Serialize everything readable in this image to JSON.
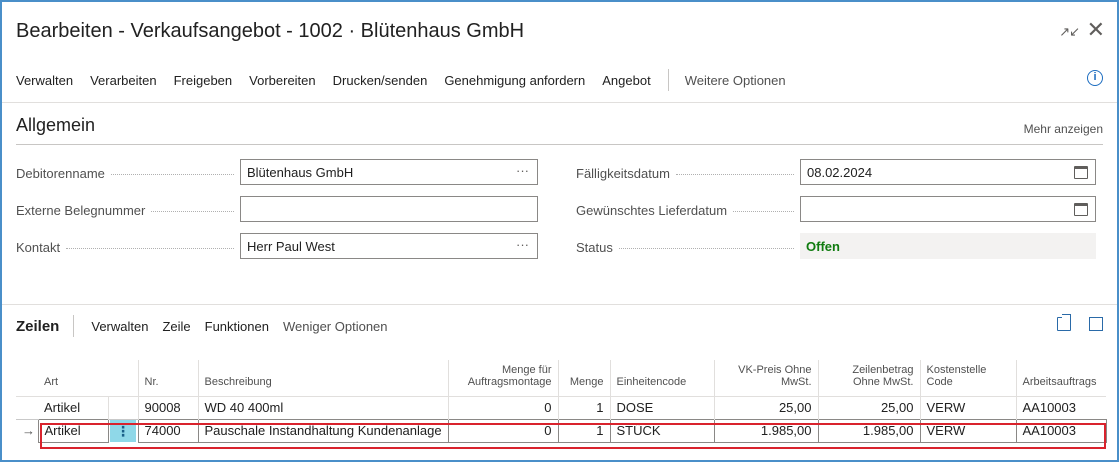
{
  "window": {
    "title": "Bearbeiten - Verkaufsangebot - 1002 · Blütenhaus GmbH",
    "collapse_icon": "collapse-icon",
    "close_icon": "close-icon"
  },
  "actionbar": {
    "items": [
      "Verwalten",
      "Verarbeiten",
      "Freigeben",
      "Vorbereiten",
      "Drucken/senden",
      "Genehmigung anfordern",
      "Angebot"
    ],
    "more": "Weitere Optionen",
    "info_icon": "info-icon"
  },
  "general": {
    "title": "Allgemein",
    "more_link": "Mehr anzeigen",
    "fields": {
      "debitorenname": {
        "label": "Debitorenname",
        "value": "Blütenhaus GmbH",
        "suffix": "···"
      },
      "externe_belegnummer": {
        "label": "Externe Belegnummer",
        "value": ""
      },
      "kontakt": {
        "label": "Kontakt",
        "value": "Herr Paul West",
        "suffix": "···"
      },
      "faelligkeitsdatum": {
        "label": "Fälligkeitsdatum",
        "value": "08.02.2024"
      },
      "gewuenschtes_lieferdatum": {
        "label": "Gewünschtes Lieferdatum",
        "value": ""
      },
      "status": {
        "label": "Status",
        "value": "Offen"
      }
    },
    "colors": {
      "status_open": "#107c10"
    }
  },
  "lines": {
    "title": "Zeilen",
    "actions": [
      "Verwalten",
      "Zeile",
      "Funktionen"
    ],
    "less": "Weniger Optionen",
    "icons": [
      "share-icon",
      "expand-icon"
    ],
    "columns": {
      "art": "Art",
      "nr": "Nr.",
      "beschreibung": "Beschreibung",
      "menge_auftragsmontage": "Menge für Auftragsmontage",
      "menge": "Menge",
      "einheitencode": "Einheitencode",
      "vk_preis": "VK-Preis Ohne MwSt.",
      "zeilenbetrag": "Zeilenbetrag Ohne MwSt.",
      "kostenstelle": "Kostenstelle Code",
      "arbeitsauftrag": "Arbeitsauftrags"
    },
    "rows": [
      {
        "art": "Artikel",
        "nr": "90008",
        "beschreibung": "WD 40 400ml",
        "menge_auftragsmontage": "0",
        "menge": "1",
        "einheitencode": "DOSE",
        "vk_preis": "25,00",
        "zeilenbetrag": "25,00",
        "kostenstelle": "VERW",
        "arbeitsauftrag": "AA10003"
      },
      {
        "art": "Artikel",
        "nr": "74000",
        "beschreibung": "Pauschale Instandhaltung Kundenanlage",
        "menge_auftragsmontage": "0",
        "menge": "1",
        "einheitencode": "STÜCK",
        "vk_preis": "1.985,00",
        "zeilenbetrag": "1.985,00",
        "kostenstelle": "VERW",
        "arbeitsauftrag": "AA10003"
      }
    ],
    "row_menu_glyph": "⋮",
    "current_row_arrow": "→",
    "colors": {
      "highlight_border": "#d9232d",
      "row_menu_bg": "#8fd8e8"
    }
  }
}
